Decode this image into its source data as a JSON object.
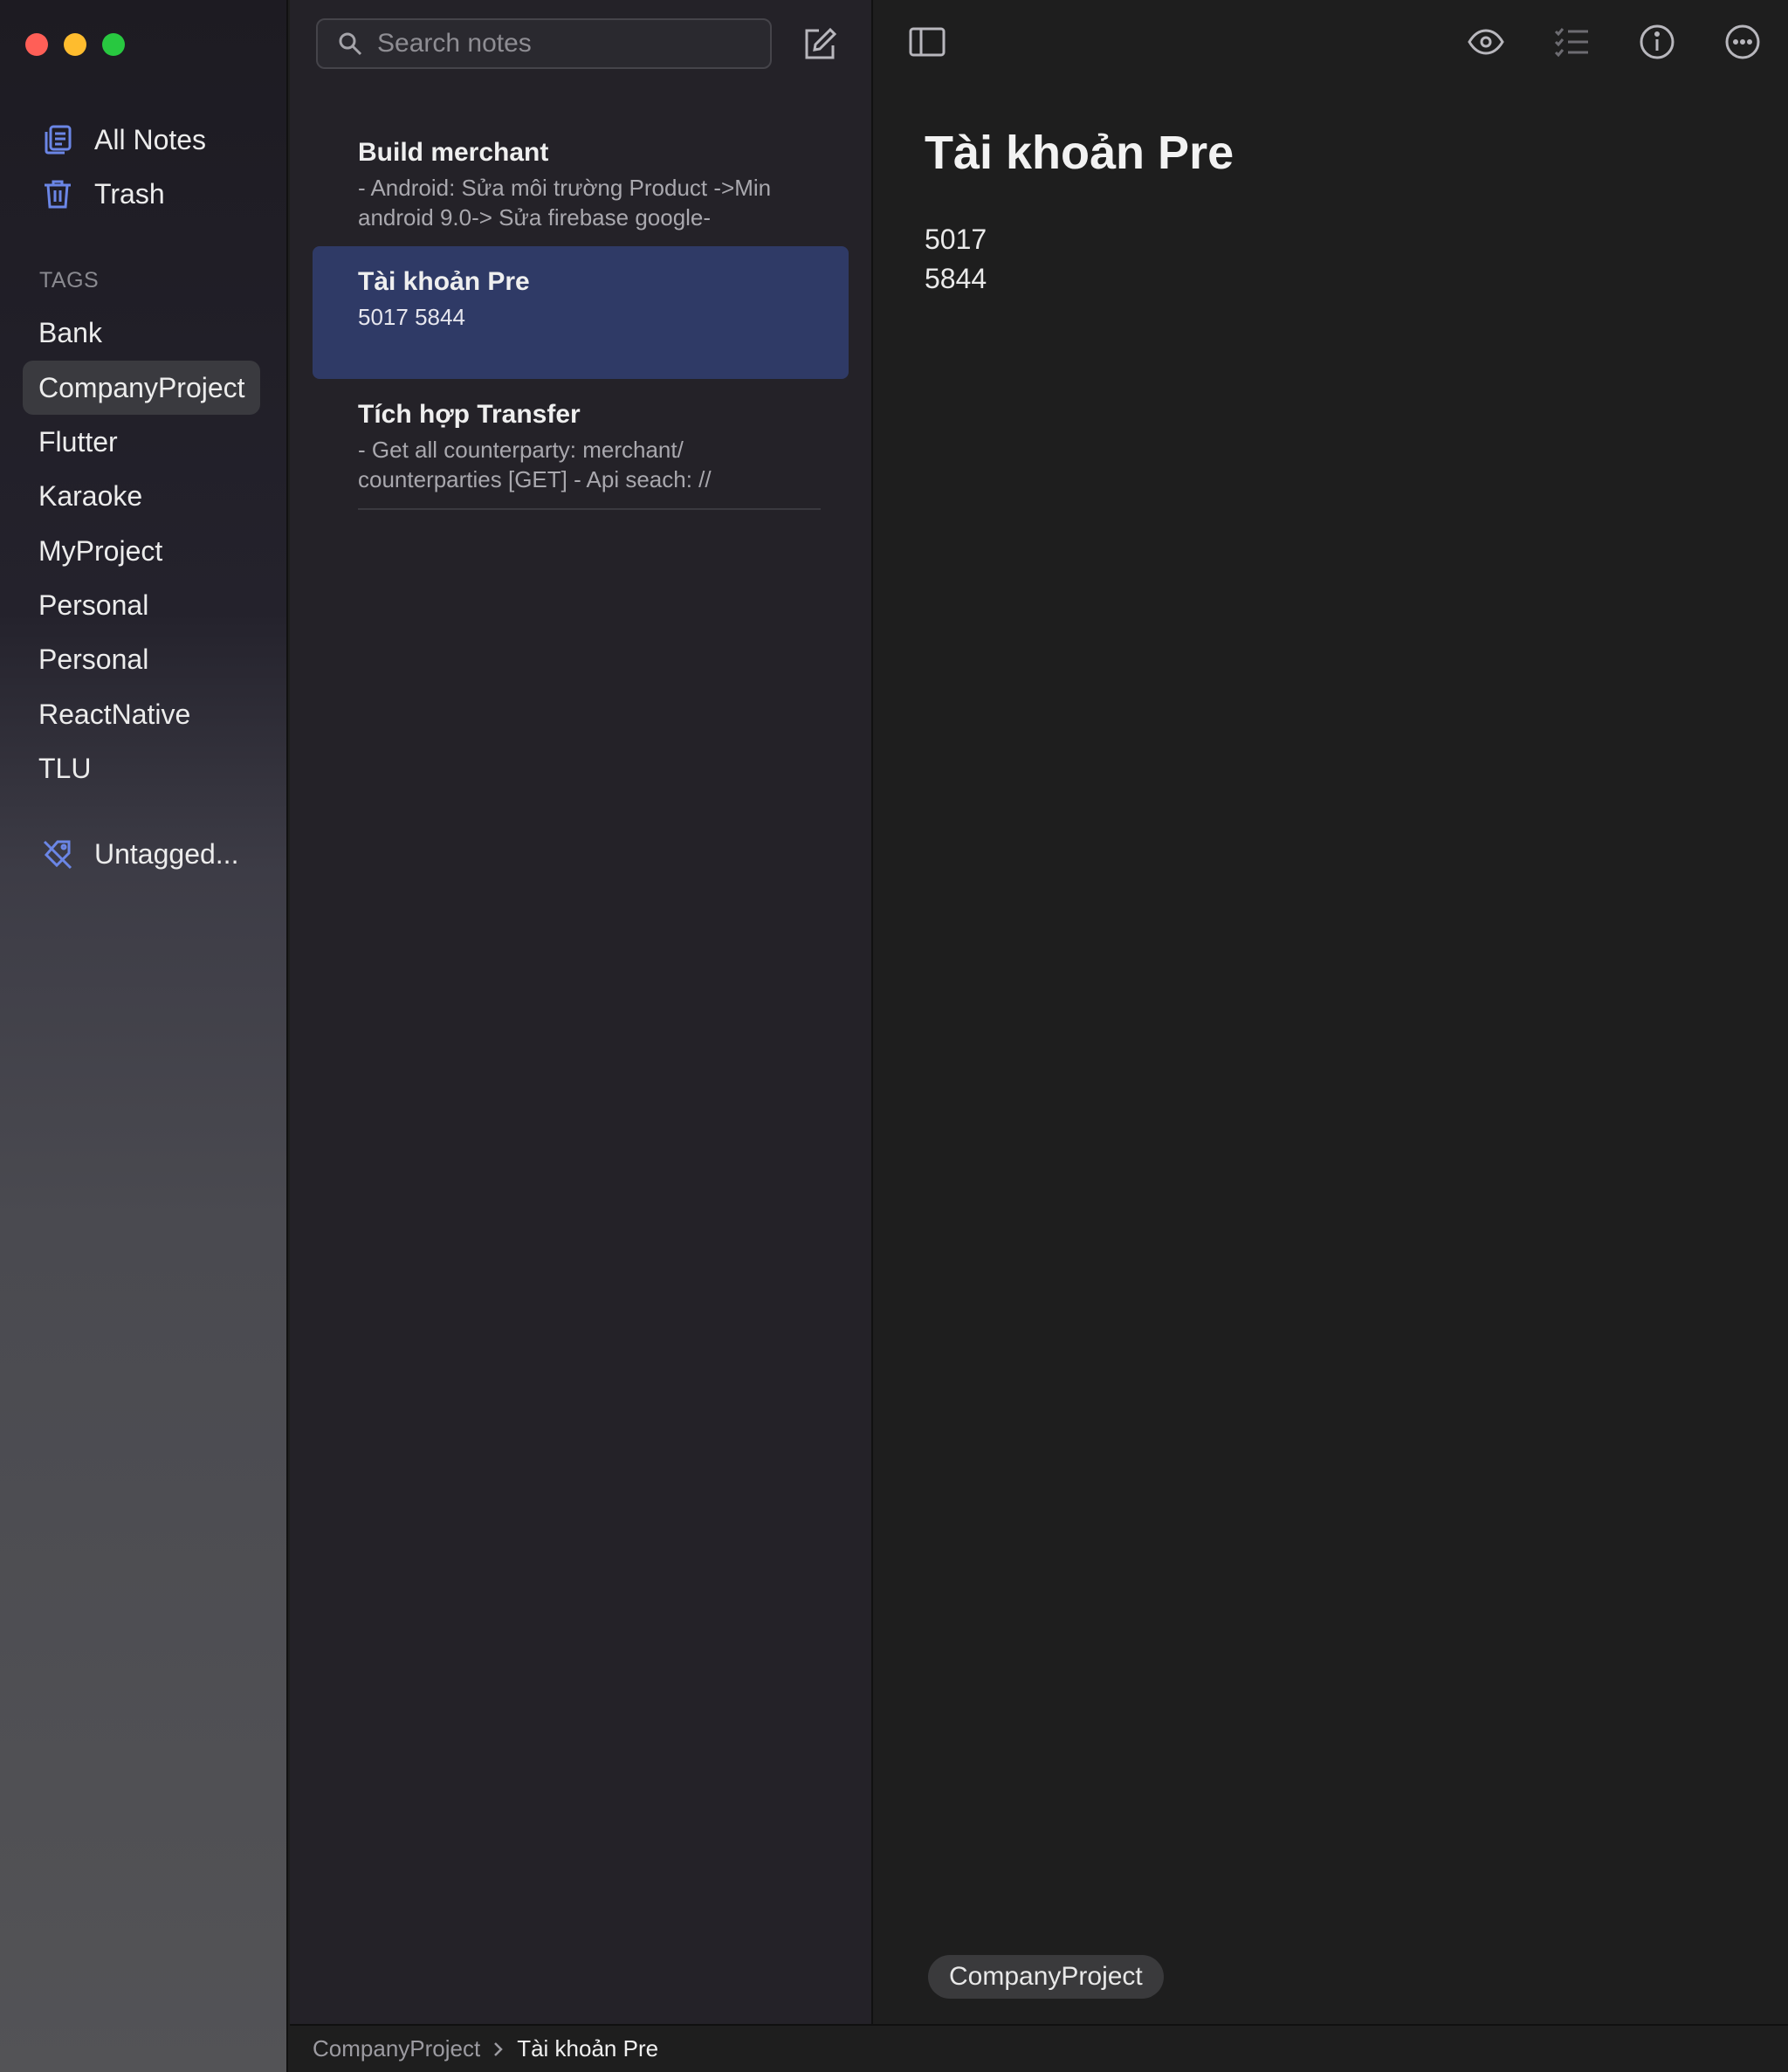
{
  "sidebar": {
    "all_notes": "All Notes",
    "trash": "Trash",
    "tags_header": "TAGS",
    "tags": [
      "Bank",
      "CompanyProject",
      "Flutter",
      "Karaoke",
      "MyProject",
      "Personal",
      "Personal",
      "ReactNative",
      "TLU"
    ],
    "active_tag": "CompanyProject",
    "untagged": "Untagged..."
  },
  "search": {
    "placeholder": "Search notes"
  },
  "notes": [
    {
      "title": "Build merchant",
      "preview": "- Android: Sửa môi trường Product ->Min android 9.0-> Sửa firebase  google-"
    },
    {
      "title": "Tài khoản Pre",
      "preview": "5017 5844"
    },
    {
      "title": "Tích hợp Transfer",
      "preview": "-  Get all counterparty: merchant/ counterparties [GET] - Api seach: //"
    }
  ],
  "editor": {
    "title": "Tài khoản Pre",
    "lines": [
      "5017",
      "5844"
    ],
    "tag": "CompanyProject"
  },
  "breadcrumb": {
    "tag": "CompanyProject",
    "note": "Tài khoản Pre"
  },
  "colors": {
    "accent": "#6b86e6",
    "selected_note": "#2f3a66",
    "active_tag_bg": "#3a3a3f"
  },
  "icons": [
    "all-notes-icon",
    "trash-icon",
    "untagged-icon",
    "search-icon",
    "compose-icon",
    "sidebar-toggle-icon",
    "preview-eye-icon",
    "checklist-icon",
    "info-icon",
    "more-icon",
    "chevron-right-icon"
  ]
}
